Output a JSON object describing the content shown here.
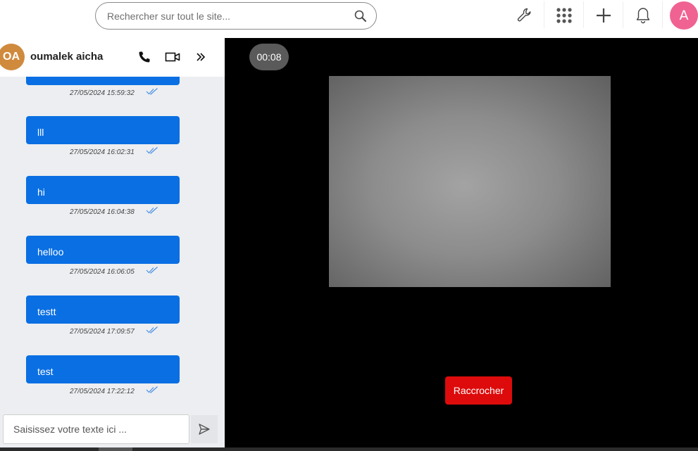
{
  "search": {
    "placeholder": "Rechercher sur tout le site..."
  },
  "toolbar": {
    "icons": [
      "wrench-icon",
      "apps-grid-icon",
      "plus-icon",
      "bell-icon"
    ],
    "user_initial": "A",
    "user_avatar_color": "#f06292"
  },
  "chat": {
    "contact": {
      "initials": "OA",
      "name": "oumalek aicha",
      "avatar_color": "#d08a3d"
    },
    "header_icons": [
      "phone-icon",
      "video-camera-icon",
      "collapse-chevrons-icon"
    ],
    "messages": [
      {
        "text": "",
        "timestamp": "27/05/2024 15:59:32",
        "status": "read-double-check-icon"
      },
      {
        "text": "lll",
        "timestamp": "27/05/2024 16:02:31",
        "status": "read-double-check-icon"
      },
      {
        "text": "hi",
        "timestamp": "27/05/2024 16:04:38",
        "status": "read-double-check-icon"
      },
      {
        "text": "helloo",
        "timestamp": "27/05/2024 16:06:05",
        "status": "read-double-check-icon"
      },
      {
        "text": "testt",
        "timestamp": "27/05/2024 17:09:57",
        "status": "read-double-check-icon"
      },
      {
        "text": "test",
        "timestamp": "27/05/2024 17:22:12",
        "status": "read-double-check-icon"
      }
    ],
    "composer": {
      "placeholder": "Saisissez votre texte ici ..."
    },
    "bubble_color": "#0a6fe3"
  },
  "call": {
    "timer": "00:08",
    "hangup_label": "Raccrocher",
    "hangup_color": "#dd0b0b"
  }
}
